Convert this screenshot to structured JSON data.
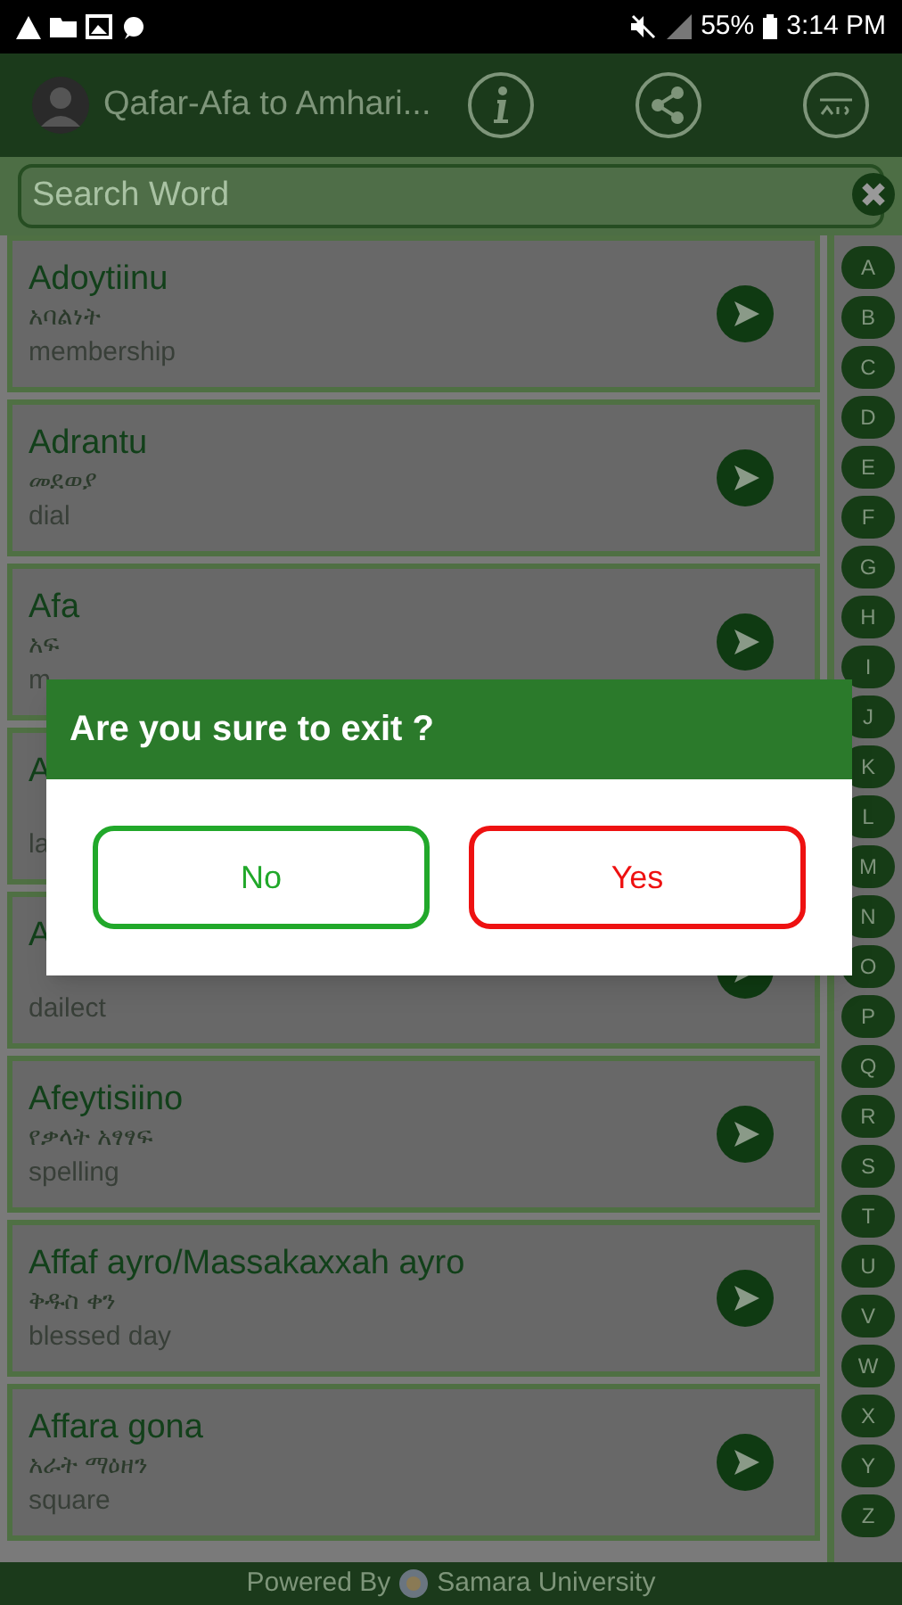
{
  "status_bar": {
    "battery": "55%",
    "time": "3:14 PM"
  },
  "header": {
    "title": "Qafar-Afa to Amhari..."
  },
  "search": {
    "placeholder": "Search Word"
  },
  "words": [
    {
      "word": "Adoytiinu",
      "amharic": "አባልነት",
      "english": "membership",
      "arrow": true
    },
    {
      "word": "Adrantu",
      "amharic": "መደወያ",
      "english": "dial",
      "arrow": true
    },
    {
      "word": "Afa",
      "amharic": "አፍ",
      "english": "m",
      "arrow": true
    },
    {
      "word": "A",
      "english": "la",
      "arrow": false
    },
    {
      "word": "A",
      "english": "dailect",
      "arrow": true
    },
    {
      "word": "Afeytisiino",
      "amharic": "የቃላት አፃፃፍ",
      "english": "spelling",
      "arrow": true
    },
    {
      "word": "Affaf ayro/Massakaxxah ayro",
      "amharic": "ቅዱስ ቀን",
      "english": "blessed day",
      "arrow": true
    },
    {
      "word": "Affara gona",
      "amharic": "አራት ማዕዘን",
      "english": "square",
      "arrow": true
    }
  ],
  "alphabet": [
    "A",
    "B",
    "C",
    "D",
    "E",
    "F",
    "G",
    "H",
    "I",
    "J",
    "K",
    "L",
    "M",
    "N",
    "O",
    "P",
    "Q",
    "R",
    "S",
    "T",
    "U",
    "V",
    "W",
    "X",
    "Y",
    "Z"
  ],
  "dialog": {
    "title": "Are you sure to exit ?",
    "buttons": [
      {
        "label": "No",
        "kind": "cancel"
      },
      {
        "label": "Yes",
        "kind": "confirm"
      }
    ]
  },
  "footer": {
    "prefix": "Powered By",
    "org": "Samara University"
  }
}
